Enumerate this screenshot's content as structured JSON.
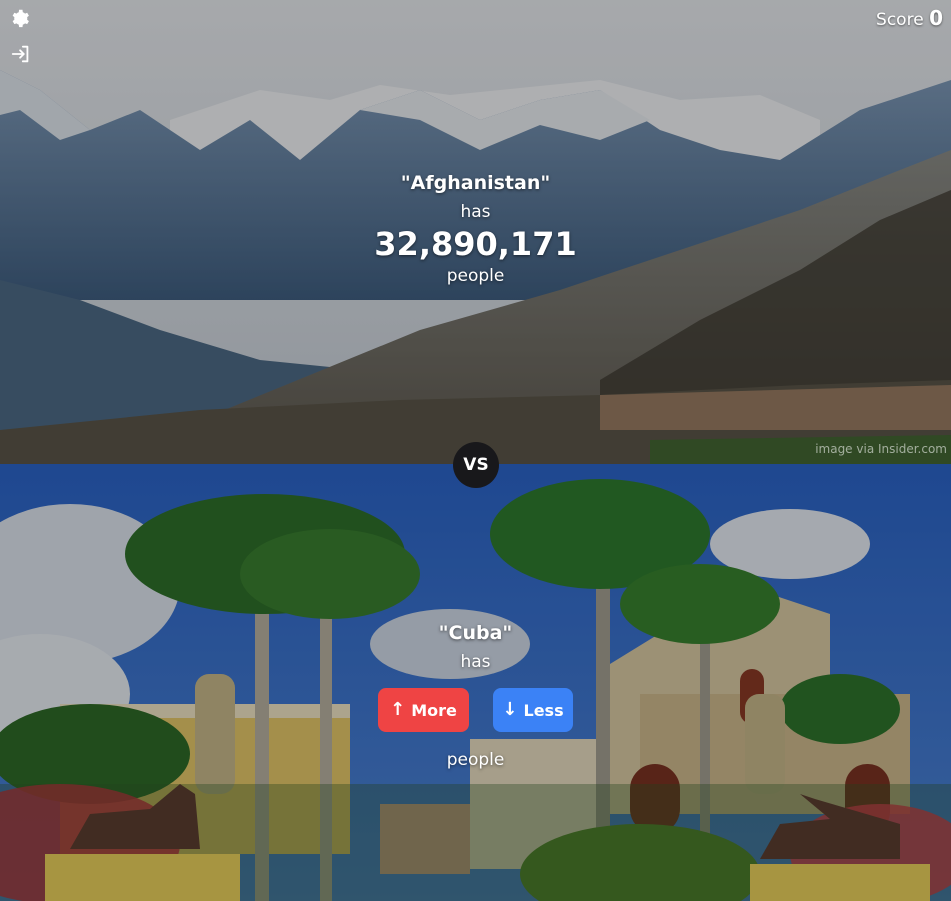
{
  "score": {
    "label": "Score",
    "value": "0"
  },
  "versus": "VS",
  "first": {
    "name": "\"Afghanistan\"",
    "has": "has",
    "count": "32,890,171",
    "unit": "people",
    "credit": "image via Insider.com"
  },
  "second": {
    "name": "\"Cuba\"",
    "has": "has",
    "unit": "people"
  },
  "buttons": {
    "more": "More",
    "less": "Less"
  },
  "colors": {
    "more": "#ef4444",
    "less": "#3b82f6",
    "vs_bg": "#18181b"
  },
  "icons": {
    "settings": "gear-icon",
    "login": "sign-in-icon",
    "more": "arrow-up-icon",
    "less": "arrow-down-icon"
  }
}
